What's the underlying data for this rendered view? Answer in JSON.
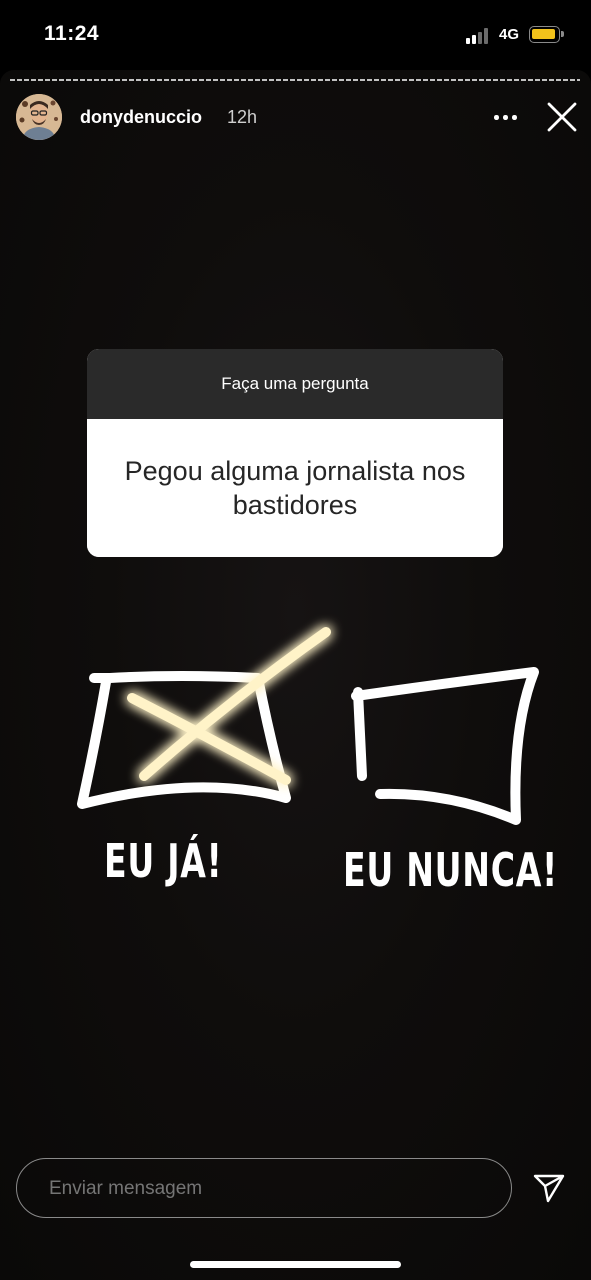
{
  "status_bar": {
    "time": "11:24",
    "network": "4G"
  },
  "colors": {
    "battery": "#f2c21b",
    "signal_active": "#ffffff",
    "signal_inactive": "#6b6b6b",
    "highlight_glow": "#f2d16b"
  },
  "story": {
    "username": "donydenuccio",
    "posted_ago": "12h",
    "icons": {
      "avatar": "profile-avatar",
      "more": "more-dots-icon",
      "close": "close-icon"
    }
  },
  "question_sticker": {
    "header": "Faça uma pergunta",
    "question": "Pegou alguma jornalista nos bastidores"
  },
  "answers": [
    {
      "label": "EU JÁ!",
      "checked": true
    },
    {
      "label": "EU NUNCA!",
      "checked": false
    }
  ],
  "composer": {
    "placeholder": "Enviar mensagem",
    "send_icon": "send-icon"
  }
}
